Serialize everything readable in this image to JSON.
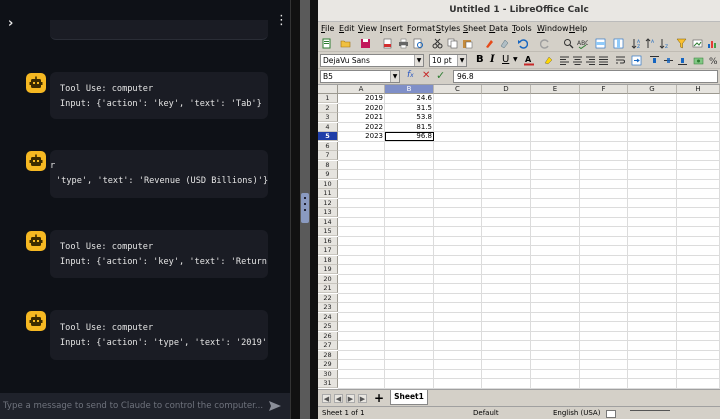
{
  "chat": {
    "messages": [
      {
        "line1": "Tool Use: computer",
        "line2": "Input: {'action': 'key', 'text': 'Tab'}"
      },
      {
        "line1": "r",
        "line2": "'type', 'text': 'Revenue (USD Billions)'}"
      },
      {
        "line1": "Tool Use: computer",
        "line2": "Input: {'action': 'key', 'text': 'Return"
      },
      {
        "line1": "Tool Use: computer",
        "line2": "Input: {'action': 'type', 'text': '2019'"
      }
    ],
    "input_placeholder": "Type a message to send to Claude to control the computer..."
  },
  "calc": {
    "title": "Untitled 1 - LibreOffice Calc",
    "menu": [
      "File",
      "Edit",
      "View",
      "Insert",
      "Format",
      "Styles",
      "Sheet",
      "Data",
      "Tools",
      "Window",
      "Help"
    ],
    "font_name": "DejaVu Sans",
    "font_size": "10 pt",
    "name_box": "B5",
    "formula_value": "96.8",
    "columns": [
      "A",
      "B",
      "C",
      "D",
      "E",
      "F",
      "G",
      "H"
    ],
    "rows": [
      "1",
      "2",
      "3",
      "4",
      "5",
      "6",
      "7",
      "8",
      "9",
      "10",
      "11",
      "12",
      "13",
      "14",
      "15",
      "16",
      "17",
      "18",
      "19",
      "20",
      "21",
      "22",
      "23",
      "24",
      "25",
      "26",
      "27",
      "28",
      "29",
      "30",
      "31"
    ],
    "data": [
      {
        "a": "2019",
        "b": "24.6"
      },
      {
        "a": "2020",
        "b": "31.5"
      },
      {
        "a": "2021",
        "b": "53.8"
      },
      {
        "a": "2022",
        "b": "81.5"
      },
      {
        "a": "2023",
        "b": "96.8"
      }
    ],
    "sheet_tab": "Sheet1",
    "status": {
      "sheet": "Sheet 1 of 1",
      "style": "Default",
      "language": "English (USA)"
    }
  }
}
